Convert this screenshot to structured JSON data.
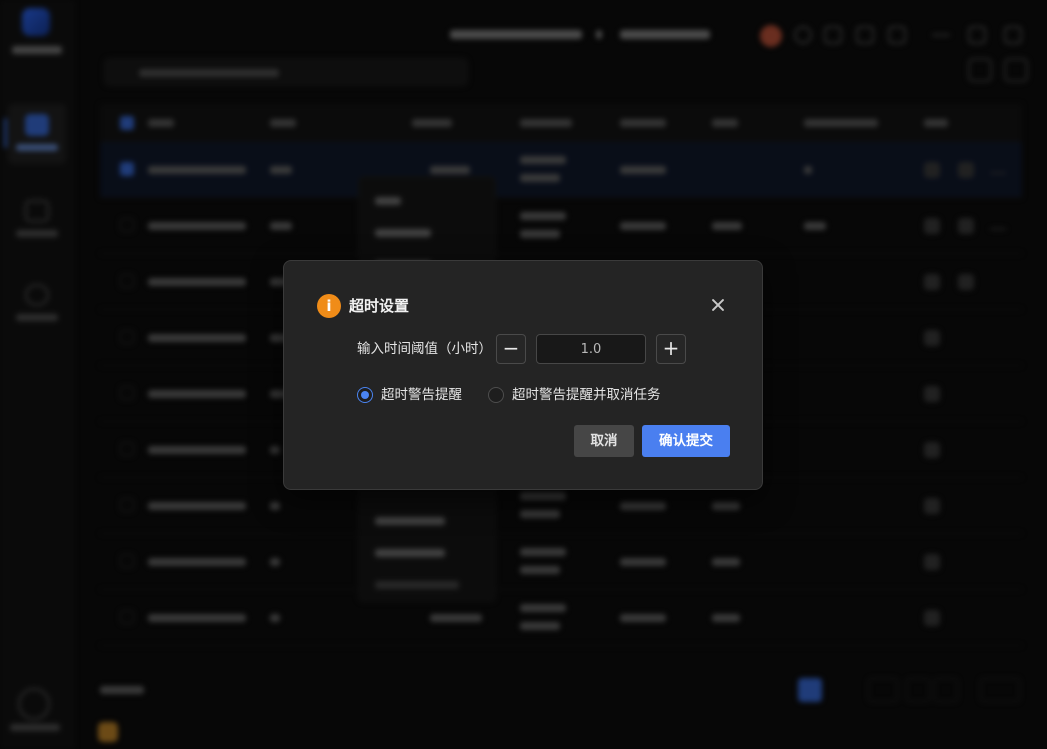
{
  "modal": {
    "title": "超时设置",
    "info_glyph": "i",
    "close_glyph": "",
    "threshold_label": "输入时间阈值（小时）",
    "stepper_minus": "−",
    "stepper_plus": "+",
    "threshold_value": "1.0",
    "options": [
      {
        "label": "超时警告提醒",
        "checked": true
      },
      {
        "label": "超时警告提醒并取消任务",
        "checked": false
      }
    ],
    "cancel_label": "取消",
    "confirm_label": "确认提交"
  },
  "colors": {
    "info_icon": "#f08c18",
    "primary": "#4a7ff0",
    "modal_bg": "#242424",
    "cancel_bg": "#464646",
    "sidebar_active": "#3b6fe0"
  },
  "icons": [
    "info-icon",
    "close-icon",
    "minus-icon",
    "plus-icon"
  ]
}
